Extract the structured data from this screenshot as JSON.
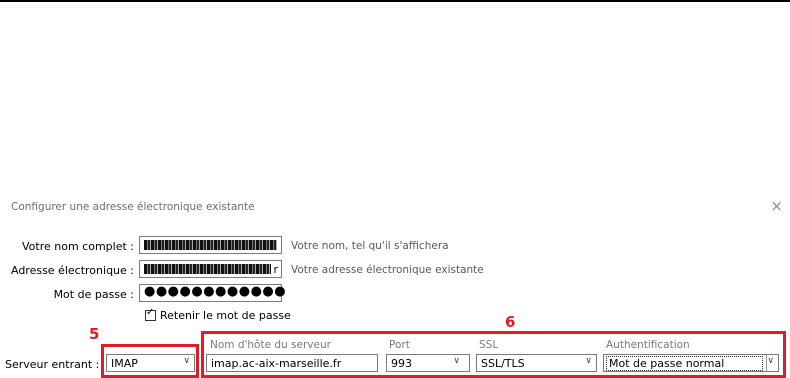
{
  "dialog": {
    "title": "Configurer une adresse électronique existante",
    "close_glyph": "×"
  },
  "form": {
    "name_label": "Votre nom complet :",
    "name_hint": "Votre nom, tel qu'il s'affichera",
    "email_label": "Adresse électronique :",
    "email_visible_suffix": "r",
    "email_hint": "Votre adresse électronique existante",
    "password_label": "Mot de passe :",
    "password_value": "●●●●●●●●●●●●",
    "remember_label": "Retenir le mot de passe",
    "remember_checked": true
  },
  "annotations": {
    "marker_5": "5",
    "marker_6": "6",
    "highlight_color": "#e01c24"
  },
  "server": {
    "col_host": "Nom d'hôte du serveur",
    "col_port": "Port",
    "col_ssl": "SSL",
    "col_auth": "Authentification",
    "incoming_label": "Serveur entrant :",
    "protocol": "IMAP",
    "host": "imap.ac-aix-marseille.fr",
    "port": "993",
    "ssl": "SSL/TLS",
    "auth": "Mot de passe normal"
  },
  "icons": {
    "chevron": "chevron-down-icon"
  }
}
